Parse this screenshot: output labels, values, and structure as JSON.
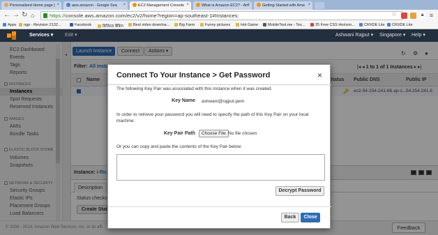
{
  "browser": {
    "tabs": [
      {
        "title": "Personalized Home page |",
        "fav": "#e8a34a"
      },
      {
        "title": "aws.amazon - Google Sea",
        "fav": "#4a80d8"
      },
      {
        "title": "EC2 Management Console",
        "fav": "#f29111"
      },
      {
        "title": "What is Amazon EC2? - Am",
        "fav": "#f29111"
      },
      {
        "title": "Getting Started with Ama",
        "fav": "#f29111"
      }
    ],
    "url_green": "https://",
    "url_rest": "console.aws.amazon.com/ec2/v2/home?region=ap-southeast-1#Instances:",
    "bookmarks": [
      "Apps",
      "ngp - Revision 2132...",
      "Facebook",
      "डिजिटल बैंकिंग",
      "Best video downloa...",
      "Big Farm",
      "Funny pictures",
      "Hot Game",
      "MobileTest.me - Tes...",
      "25 Free CSS Horizon...",
      "CRXDE Lite",
      "CRXDE Lite"
    ]
  },
  "aws_nav": {
    "services": "Services",
    "edit": "Edit",
    "user": "Ashwani Rajput",
    "region": "Singapore",
    "help": "Help"
  },
  "sidebar": {
    "ec2_dashboard": "EC2 Dashboard",
    "events": "Events",
    "tags": "Tags",
    "reports": "Reports",
    "group_instances": "INSTANCES",
    "instances": "Instances",
    "spot_requests": "Spot Requests",
    "reserved_instances": "Reserved Instances",
    "group_images": "IMAGES",
    "amis": "AMIs",
    "bundle_tasks": "Bundle Tasks",
    "group_ebs": "ELASTIC BLOCK STORE",
    "volumes": "Volumes",
    "snapshots": "Snapshots",
    "group_network": "NETWORK & SECURITY",
    "security_groups": "Security Groups",
    "elastic_ips": "Elastic IPs",
    "placement_groups": "Placement Groups",
    "load_balancers": "Load Balancers"
  },
  "toolbar": {
    "launch": "Launch Instance",
    "connect": "Connect",
    "actions": "Actions"
  },
  "filter": {
    "label": "Filter:",
    "value": "All insta",
    "pager": "1 to 1 of 1 Instances"
  },
  "table": {
    "col_name": "Name",
    "col_status": "Status",
    "col_public_dns": "Public DNS",
    "col_public_ip": "Public IP",
    "row_dns": "ec2-54-254-241-66.ap-s...",
    "row_ip": "54.254.241.6"
  },
  "detail": {
    "instance_label": "Instance:",
    "instance_value": "i-f0c",
    "tab_description": "Description",
    "status_checks": "Status checks",
    "create_btn": "Create Stat"
  },
  "footer": {
    "copyright": "© 2008 - 2014, Amazon Web Services, Inc. or its affi",
    "feedback": "Feedback"
  },
  "modal": {
    "title": "Connect To Your Instance > Get Password",
    "close_glyph": "×",
    "intro": "The following Key Pair was associated with this instance when it was created.",
    "key_name_label": "Key Name",
    "key_name_value": "ashwani@rajput.pem",
    "retrieve_line1": "In order to retrieve your password you will need to specify the path of this Key Pair on your local",
    "retrieve_line2": "machine:",
    "key_pair_path_label": "Key Pair Path",
    "choose_file": "Choose File",
    "no_file": "No file chosen",
    "paste_text": "Or you can copy and paste the contents of the Key Pair below:",
    "textarea_value": "",
    "decrypt": "Decrypt Password",
    "back": "Back",
    "close": "Close"
  },
  "colors": {
    "aws_nav": "#232f3e",
    "primary_button": "#2e6db4",
    "aws_orange": "#f29111"
  }
}
